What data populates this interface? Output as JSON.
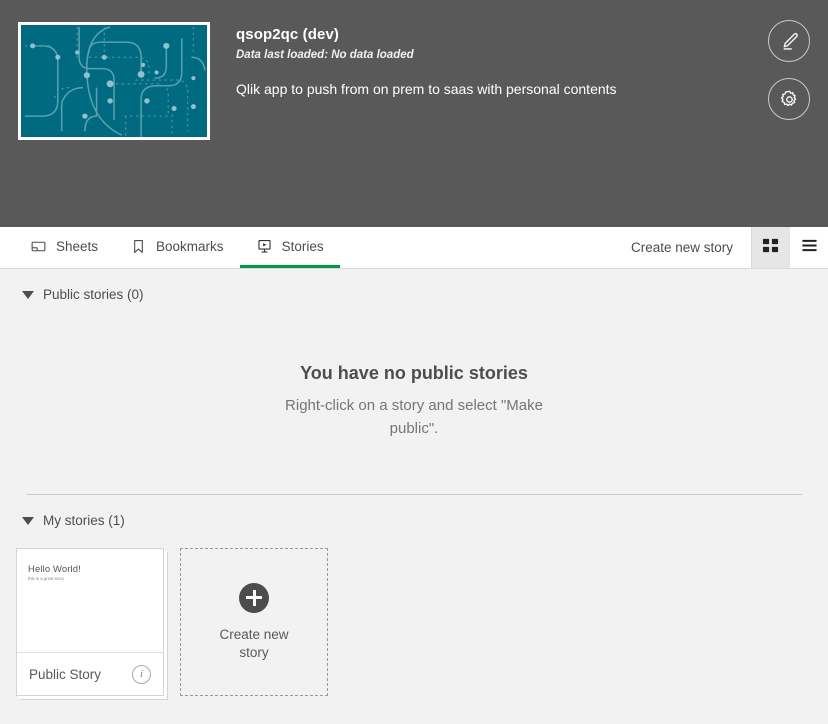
{
  "header": {
    "app_title": "qsop2qc (dev)",
    "data_status": "Data last loaded: No data loaded",
    "description": "Qlik app to push from on prem to saas with personal contents",
    "thumbnail_color": "#006a80",
    "background_color": "#595959",
    "actions": [
      {
        "name": "edit-app-button",
        "icon": "pencil-icon"
      },
      {
        "name": "app-settings-button",
        "icon": "gear-icon"
      }
    ]
  },
  "tabbar": {
    "tabs": [
      {
        "label": "Sheets",
        "icon": "sheet-icon",
        "active": false
      },
      {
        "label": "Bookmarks",
        "icon": "bookmark-icon",
        "active": false
      },
      {
        "label": "Stories",
        "icon": "story-icon",
        "active": true
      }
    ],
    "create_label": "Create new story",
    "active_underline_color": "#009845",
    "view_modes": [
      {
        "name": "grid-view-button",
        "icon": "grid-icon",
        "selected": true
      },
      {
        "name": "list-view-button",
        "icon": "list-icon",
        "selected": false
      }
    ]
  },
  "public_section": {
    "title": "Public stories (0)",
    "empty_title": "You have no public stories",
    "empty_subtitle": "Right-click on a story and select \"Make public\"."
  },
  "my_section": {
    "title": "My stories (1)",
    "stories": [
      {
        "label": "Public Story",
        "preview_title": "Hello World!",
        "preview_subtitle": "this is a great story",
        "info_icon": "info-icon"
      }
    ],
    "create_card": {
      "label": "Create new story",
      "icon": "plus-circle-icon"
    }
  }
}
